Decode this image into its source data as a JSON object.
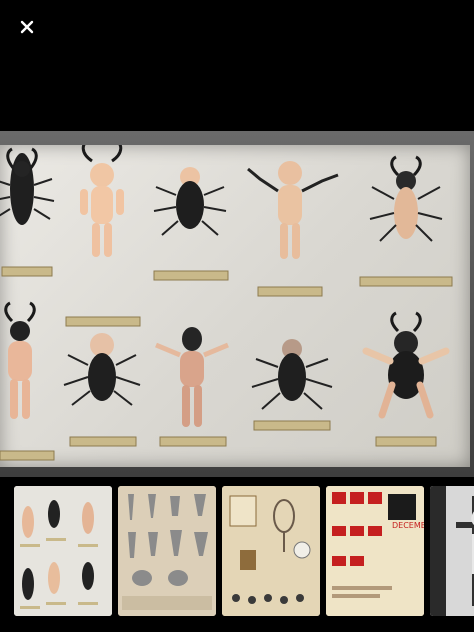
{
  "viewer": {
    "close_icon": "close-icon",
    "close_glyph": "✕"
  },
  "main_image": {
    "labels": [
      "",
      "",
      "",
      "",
      "",
      "",
      "",
      "",
      "",
      ""
    ]
  },
  "thumbnails": [
    {
      "id": "thumb-specimen-dolls"
    },
    {
      "id": "thumb-teeth-chart"
    },
    {
      "id": "thumb-curiosities"
    },
    {
      "id": "thumb-december-calendar",
      "text": "DECEMB"
    },
    {
      "id": "thumb-crucifix"
    }
  ]
}
